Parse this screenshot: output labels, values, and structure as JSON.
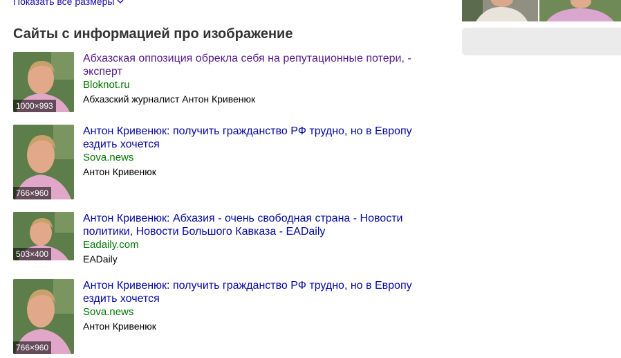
{
  "top_link": {
    "label": "Показать все размеры"
  },
  "section": {
    "title": "Сайты с информацией про изображение"
  },
  "results": [
    {
      "dims": "1000×993",
      "title_line1": "Абхазская оппозиция обрекла себя на репутационные потери, -",
      "title_line2": "эксперт",
      "host": "Bloknot.ru",
      "desc": "Абхазский журналист Антон Кривенюк",
      "visited": true
    },
    {
      "dims": "766×960",
      "title_line1": "Антон Кривенюк: получить гражданство РФ трудно, но в Европу",
      "title_line2": "ездить хочется",
      "host": "Sova.news",
      "desc": "Антон Кривенюк",
      "visited": false
    },
    {
      "dims": "503×400",
      "title_line1": "Антон Кривенюк: Абхазия - очень свободная страна - Новости",
      "title_line2": "политики, Новости Большого Кавказа - EADaily",
      "host": "Eadaily.com",
      "desc": "EADaily",
      "visited": false
    },
    {
      "dims": "766×960",
      "title_line1": "Антон Кривенюк: получить гражданство РФ трудно, но в Европу",
      "title_line2": "ездить хочется",
      "host": "Sova.news",
      "desc": "Антон Кривенюк",
      "visited": false
    }
  ],
  "colors": {
    "link": "#04089c",
    "visited": "#551a8b",
    "host": "#007700",
    "side_box": "#ebebeb"
  }
}
